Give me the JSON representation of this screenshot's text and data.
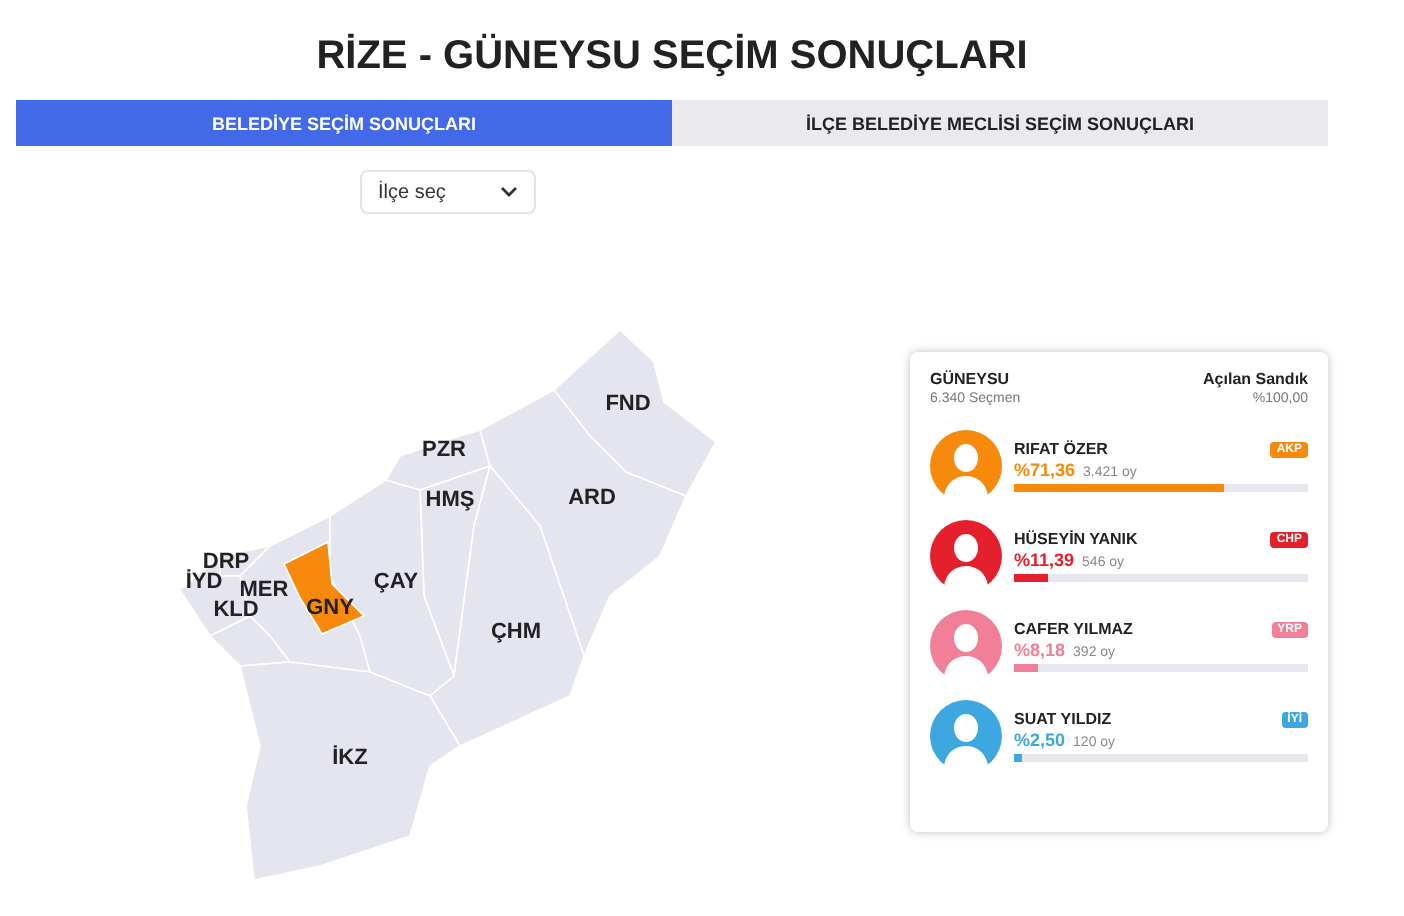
{
  "title": "RİZE - GÜNEYSU SEÇİM SONUÇLARI",
  "tabs": [
    {
      "label": "BELEDİYE SEÇİM SONUÇLARI",
      "selected": true
    },
    {
      "label": "İLÇE BELEDİYE MECLİSİ SEÇİM SONUÇLARI",
      "selected": false
    }
  ],
  "district_select": {
    "value": "İlçe seç"
  },
  "map": {
    "districts": [
      {
        "label": "FND",
        "selected": false
      },
      {
        "label": "PZR",
        "selected": false
      },
      {
        "label": "HMŞ",
        "selected": false
      },
      {
        "label": "ARD",
        "selected": false
      },
      {
        "label": "DRP",
        "selected": false
      },
      {
        "label": "İYD",
        "selected": false
      },
      {
        "label": "MER",
        "selected": false
      },
      {
        "label": "GNY",
        "selected": true
      },
      {
        "label": "ÇAY",
        "selected": false
      },
      {
        "label": "KLD",
        "selected": false
      },
      {
        "label": "ÇHM",
        "selected": false
      },
      {
        "label": "İKZ",
        "selected": false
      }
    ]
  },
  "results": {
    "place": "GÜNEYSU",
    "voters": "6.340 Seçmen",
    "opened_label": "Açılan Sandık",
    "opened_value": "%100,00",
    "candidates": [
      {
        "name": "RIFAT ÖZER",
        "percent": "%71,36",
        "votes": "3.421 oy",
        "party": "AKP",
        "color": "#f7890c",
        "level": 0.7136
      },
      {
        "name": "HÜSEYİN YANIK",
        "percent": "%11,39",
        "votes": "546 oy",
        "party": "CHP",
        "color": "#e3202b",
        "level": 0.1139
      },
      {
        "name": "CAFER YILMAZ",
        "percent": "%8,18",
        "votes": "392 oy",
        "party": "YRP",
        "color": "#f07f97",
        "level": 0.0818
      },
      {
        "name": "SUAT YILDIZ",
        "percent": "%2,50",
        "votes": "120 oy",
        "party": "İYİ",
        "color": "#3da8e0",
        "level": 0.025
      }
    ]
  }
}
